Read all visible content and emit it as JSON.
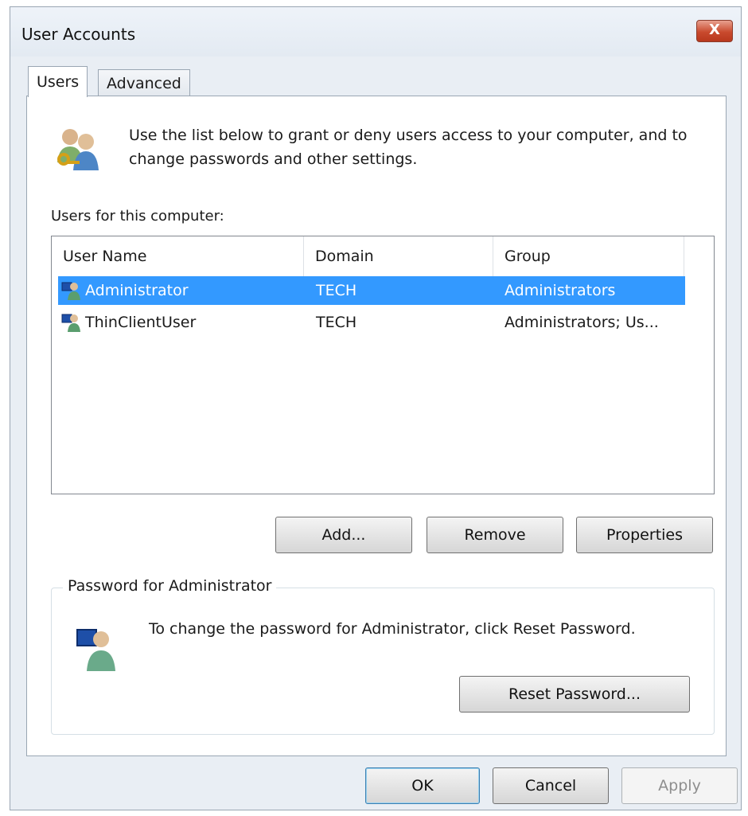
{
  "window": {
    "title": "User Accounts",
    "close_glyph": "X"
  },
  "tabs": [
    {
      "label": "Users",
      "active": true
    },
    {
      "label": "Advanced",
      "active": false
    }
  ],
  "intro": {
    "icon": "users-key-icon",
    "text": "Use the list below to grant or deny users access to your computer, and to change passwords and other settings."
  },
  "users_list": {
    "label": "Users for this computer:",
    "columns": [
      "User Name",
      "Domain",
      "Group"
    ],
    "rows": [
      {
        "user": "Administrator",
        "domain": "TECH",
        "group": "Administrators",
        "selected": true
      },
      {
        "user": "ThinClientUser",
        "domain": "TECH",
        "group": "Administrators; Us...",
        "selected": false
      }
    ]
  },
  "list_buttons": {
    "add": "Add...",
    "remove": "Remove",
    "properties": "Properties"
  },
  "password": {
    "legend": "Password for Administrator",
    "text": "To change the password for Administrator, click Reset Password.",
    "reset_button": "Reset Password..."
  },
  "footer": {
    "ok": "OK",
    "cancel": "Cancel",
    "apply": "Apply"
  },
  "colors": {
    "selection": "#3399ff",
    "close_button": "#c94a2e"
  }
}
